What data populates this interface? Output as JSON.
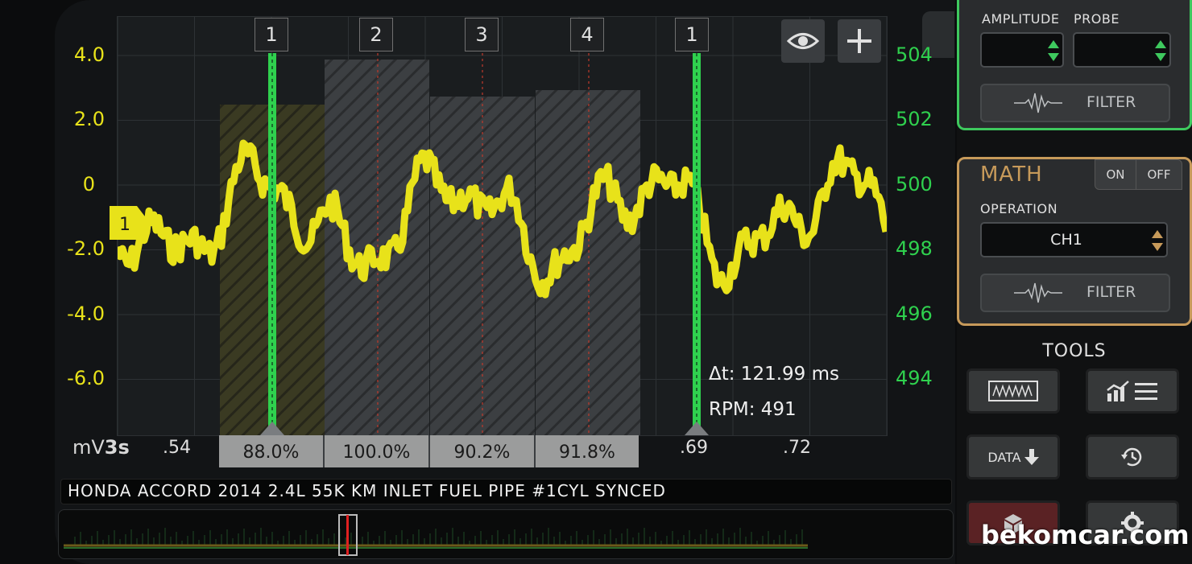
{
  "plot": {
    "left_axis": [
      "4.0",
      "2.0",
      "0",
      "-2.0",
      "-4.0",
      "-6.0"
    ],
    "right_axis": [
      "504",
      "502",
      "500",
      "498",
      "496",
      "494"
    ],
    "unit_label": "mV",
    "timebase": "3s",
    "x_ticks": [
      ".54",
      ".69",
      ".72"
    ],
    "cylinders": [
      "1",
      "2",
      "3",
      "4",
      "1"
    ],
    "percentages": [
      "88.0%",
      "100.0%",
      "90.2%",
      "91.8%"
    ],
    "channel_marker": "1",
    "delta_t": "Δt: 121.99 ms",
    "rpm": "RPM: 491",
    "colors": {
      "trace": "#e8e21a",
      "cursor": "#2fd14e",
      "bars": "#5a5d60"
    }
  },
  "toolbar": {
    "eye_icon": "eye-icon",
    "add_icon": "plus-icon"
  },
  "title": "HONDA ACCORD 2014 2.4L 55K KM INLET FUEL PIPE #1CYL SYNCED",
  "channel_panel": {
    "amplitude_label": "AMPLITUDE",
    "probe_label": "PROBE",
    "filter_label": "FILTER"
  },
  "math_panel": {
    "title": "MATH",
    "on": "ON",
    "off": "OFF",
    "operation_label": "OPERATION",
    "operation_value": "CH1",
    "filter_label": "FILTER"
  },
  "tools": {
    "title": "TOOLS",
    "data_label": "DATA"
  },
  "watermark": "bekomcar.com"
}
